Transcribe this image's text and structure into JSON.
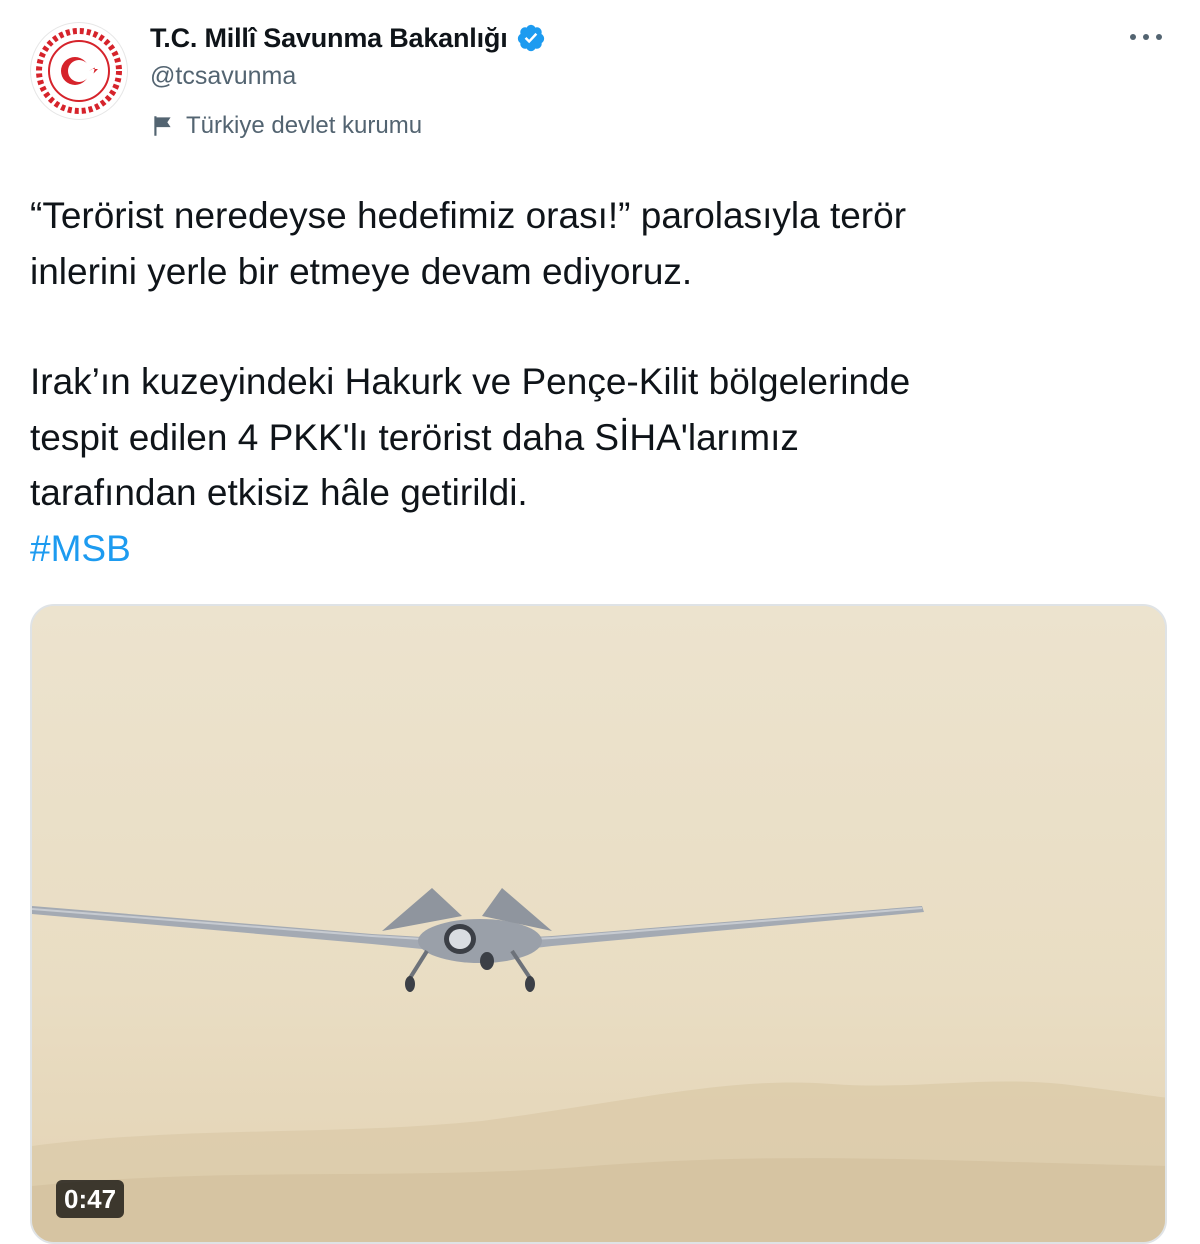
{
  "account": {
    "display_name": "T.C. Millî Savunma Bakanlığı",
    "handle": "@tcsavunma",
    "label": "Türkiye devlet kurumu",
    "verified_icon": "verified-badge-icon",
    "label_icon": "flag-icon",
    "avatar_icon": "msb-emblem-icon"
  },
  "menu": {
    "icon": "more-options-icon"
  },
  "tweet": {
    "line_1": "“Terörist neredeyse hedefimiz orası!” parolasıyla terör",
    "line_2": "inlerini yerle bir etmeye devam ediyoruz.",
    "line_3": "Irak’ın kuzeyindeki Hakurk ve Pençe-Kilit bölgelerinde",
    "line_4": "tespit edilen 4 PKK'lı terörist daha SİHA'larımız",
    "line_5": "tarafından etkisiz hâle getirildi.",
    "hashtag": "#MSB"
  },
  "media": {
    "type": "video",
    "duration": "0:47"
  },
  "colors": {
    "text": "#0f1419",
    "secondary": "#536471",
    "link": "#1d9bf0",
    "verified": "#1d9bf0",
    "emblem_red": "#d6232b"
  }
}
